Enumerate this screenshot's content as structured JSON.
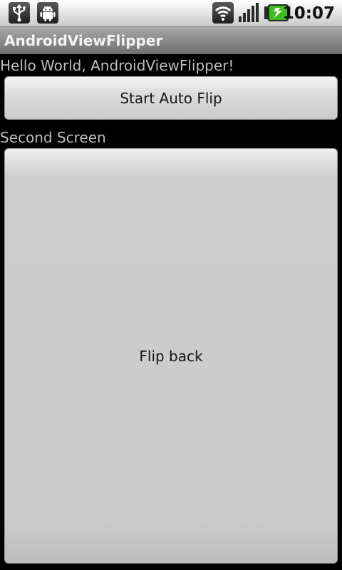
{
  "status_bar": {
    "time": "10:07",
    "icons": [
      "usb-icon",
      "android-debug-icon",
      "wifi-icon",
      "signal-icon",
      "battery-charging-icon"
    ]
  },
  "app": {
    "title": "AndroidViewFlipper"
  },
  "content": {
    "hello_text": "Hello World, AndroidViewFlipper!",
    "start_button_label": "Start Auto Flip",
    "second_text": "Second Screen",
    "flip_back_label": "Flip back"
  },
  "colors": {
    "background": "#000000",
    "button_face": "#cbcbcb",
    "title_text": "#f2f2f2",
    "body_text": "#bdbdbd",
    "battery_green": "#3cbf1e"
  }
}
